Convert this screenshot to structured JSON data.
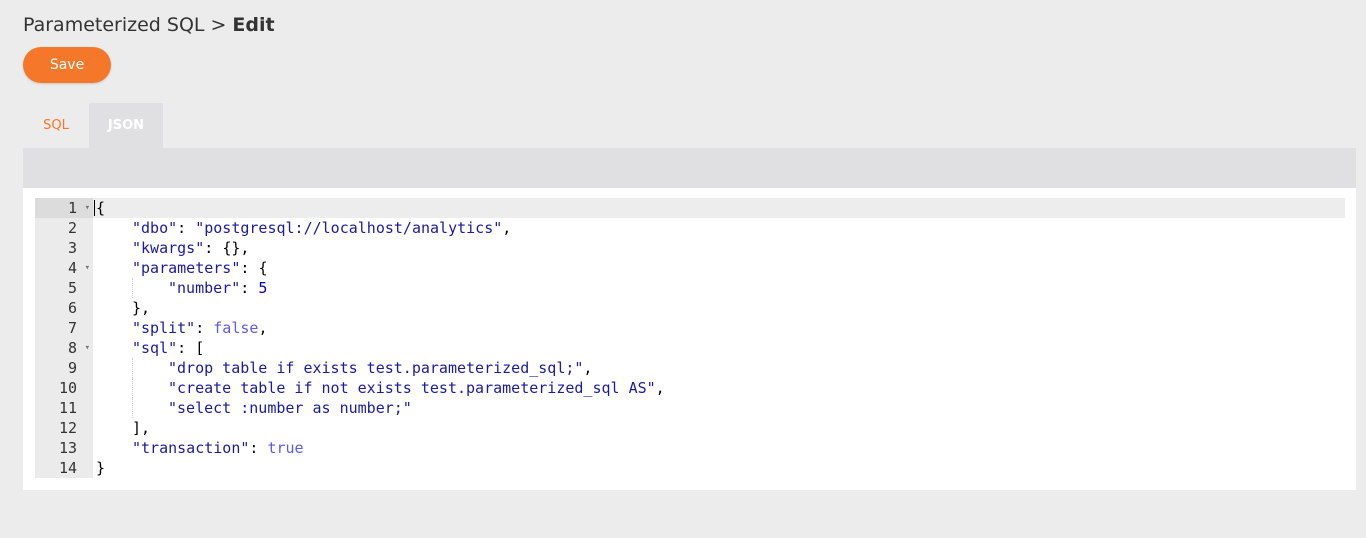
{
  "breadcrumb": {
    "parent": "Parameterized SQL",
    "separator": ">",
    "current": "Edit"
  },
  "toolbar": {
    "save_label": "Save"
  },
  "tabs": [
    {
      "label": "SQL",
      "active": false
    },
    {
      "label": "JSON",
      "active": true
    }
  ],
  "editor": {
    "line_numbers": [
      "1",
      "2",
      "3",
      "4",
      "5",
      "6",
      "7",
      "8",
      "9",
      "10",
      "11",
      "12",
      "13",
      "14"
    ],
    "fold_icon": "fold-arrow-icon",
    "lines": {
      "l1": {
        "text": "{"
      },
      "l2": {
        "key": "\"dbo\"",
        "sep": ": ",
        "value": "\"postgresql://localhost/analytics\"",
        "tail": ","
      },
      "l3": {
        "key": "\"kwargs\"",
        "sep": ": ",
        "value": "{}",
        "tail": ","
      },
      "l4": {
        "key": "\"parameters\"",
        "sep": ": ",
        "value": "{"
      },
      "l5": {
        "key": "\"number\"",
        "sep": ": ",
        "value": "5"
      },
      "l6": {
        "text": "},"
      },
      "l7": {
        "key": "\"split\"",
        "sep": ": ",
        "value": "false",
        "tail": ","
      },
      "l8": {
        "key": "\"sql\"",
        "sep": ": ",
        "value": "["
      },
      "l9": {
        "value": "\"drop table if exists test.parameterized_sql;\"",
        "tail": ","
      },
      "l10": {
        "value": "\"create table if not exists test.parameterized_sql AS\"",
        "tail": ","
      },
      "l11": {
        "value": "\"select :number as number;\""
      },
      "l12": {
        "text": "],"
      },
      "l13": {
        "key": "\"transaction\"",
        "sep": ": ",
        "value": "true"
      },
      "l14": {
        "text": "}"
      }
    }
  },
  "colors": {
    "accent": "#f5782a",
    "string": "#1a1aa6",
    "number": "#0000cd",
    "boolean": "#5b5bf0"
  }
}
